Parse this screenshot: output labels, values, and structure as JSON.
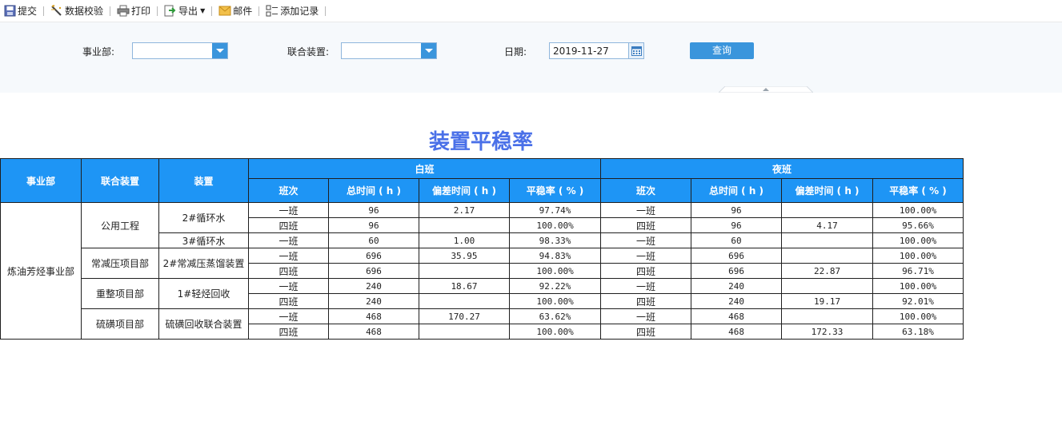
{
  "toolbar": {
    "submit": "提交",
    "validate": "数据校验",
    "print": "打印",
    "export": "导出",
    "mail": "邮件",
    "add_record": "添加记录"
  },
  "filter": {
    "division_label": "事业部:",
    "division_value": "",
    "unit_label": "联合装置:",
    "unit_value": "",
    "date_label": "日期:",
    "date_value": "2019-11-27",
    "query_button": "查询"
  },
  "report": {
    "title": "装置平稳率",
    "headers": {
      "division": "事业部",
      "unit": "联合装置",
      "device": "装置",
      "day": "白班",
      "night": "夜班",
      "shift": "班次",
      "total_time": "总时间 ( h )",
      "deviation_time": "偏差时间 ( h )",
      "rate": "平稳率 ( % )"
    },
    "division": "炼油芳烃事业部",
    "units": [
      "公用工程",
      "常减压项目部",
      "重整项目部",
      "硫磺项目部"
    ],
    "devices": [
      "2#循环水",
      "3#循环水",
      "2#常减压蒸馏装置",
      "1#轻烃回收",
      "硫磺回收联合装置"
    ],
    "rows": [
      {
        "d_shift": "一班",
        "d_total": "96",
        "d_dev": "2.17",
        "d_rate": "97.74%",
        "n_shift": "一班",
        "n_total": "96",
        "n_dev": "",
        "n_rate": "100.00%"
      },
      {
        "d_shift": "四班",
        "d_total": "96",
        "d_dev": "",
        "d_rate": "100.00%",
        "n_shift": "四班",
        "n_total": "96",
        "n_dev": "4.17",
        "n_rate": "95.66%"
      },
      {
        "d_shift": "一班",
        "d_total": "60",
        "d_dev": "1.00",
        "d_rate": "98.33%",
        "n_shift": "一班",
        "n_total": "60",
        "n_dev": "",
        "n_rate": "100.00%"
      },
      {
        "d_shift": "一班",
        "d_total": "696",
        "d_dev": "35.95",
        "d_rate": "94.83%",
        "n_shift": "一班",
        "n_total": "696",
        "n_dev": "",
        "n_rate": "100.00%"
      },
      {
        "d_shift": "四班",
        "d_total": "696",
        "d_dev": "",
        "d_rate": "100.00%",
        "n_shift": "四班",
        "n_total": "696",
        "n_dev": "22.87",
        "n_rate": "96.71%"
      },
      {
        "d_shift": "一班",
        "d_total": "240",
        "d_dev": "18.67",
        "d_rate": "92.22%",
        "n_shift": "一班",
        "n_total": "240",
        "n_dev": "",
        "n_rate": "100.00%"
      },
      {
        "d_shift": "四班",
        "d_total": "240",
        "d_dev": "",
        "d_rate": "100.00%",
        "n_shift": "四班",
        "n_total": "240",
        "n_dev": "19.17",
        "n_rate": "92.01%"
      },
      {
        "d_shift": "一班",
        "d_total": "468",
        "d_dev": "170.27",
        "d_rate": "63.62%",
        "n_shift": "一班",
        "n_total": "468",
        "n_dev": "",
        "n_rate": "100.00%"
      },
      {
        "d_shift": "四班",
        "d_total": "468",
        "d_dev": "",
        "d_rate": "100.00%",
        "n_shift": "四班",
        "n_total": "468",
        "n_dev": "172.33",
        "n_rate": "63.18%"
      }
    ]
  },
  "colors": {
    "header_bg": "#1e95f5",
    "title": "#4a70e8",
    "button": "#3a95dc",
    "filter_bg": "#f6f9fc"
  },
  "icons": [
    "save-icon",
    "validate-icon",
    "print-icon",
    "export-icon",
    "mail-icon",
    "add-record-icon",
    "calendar-icon",
    "dropdown-arrow-icon"
  ]
}
